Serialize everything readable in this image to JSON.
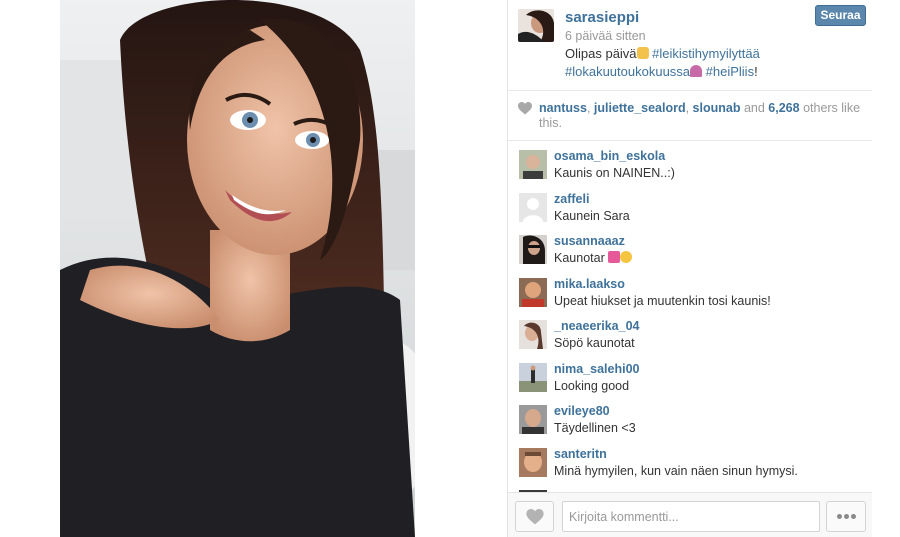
{
  "post": {
    "photo_icon": "selfie-photo",
    "owner": {
      "username": "sarasieppi",
      "time": "6 päivää sitten"
    },
    "follow_label": "Seuraa",
    "caption": {
      "text": "Olipas päivä",
      "hashtag1": "#leikistihymyilyttää",
      "hashtag2": "#lokakuutoukokuussa",
      "hashtag3": "#heiPliis",
      "end": "!"
    },
    "likes": {
      "user1": "nantuss",
      "user2": "juliette_sealord",
      "user3": "slounab",
      "and": "and",
      "count": "6,268",
      "rest": "others like this."
    }
  },
  "comments": [
    {
      "user": "osama_bin_eskola",
      "text": "Kaunis on NAINEN..:)"
    },
    {
      "user": "zaffeli",
      "text": "Kaunein Sara"
    },
    {
      "user": "susannaaaz",
      "text": "Kaunotar"
    },
    {
      "user": "mika.laakso",
      "text": "Upeat hiukset ja muutenkin tosi kaunis!"
    },
    {
      "user": "_neaeerika_04",
      "text": "Söpö kaunotat"
    },
    {
      "user": "nima_salehi00",
      "text": "Looking good"
    },
    {
      "user": "evileye80",
      "text": "Täydellinen <3"
    },
    {
      "user": "santeritn",
      "text": "Minä hymyilen, kun vain näen sinun hymysi."
    }
  ],
  "footer": {
    "comment_placeholder": "Kirjoita kommentti..."
  },
  "colors": {
    "link": "#3f729b",
    "button": "#5b87ad",
    "muted": "#999999"
  }
}
